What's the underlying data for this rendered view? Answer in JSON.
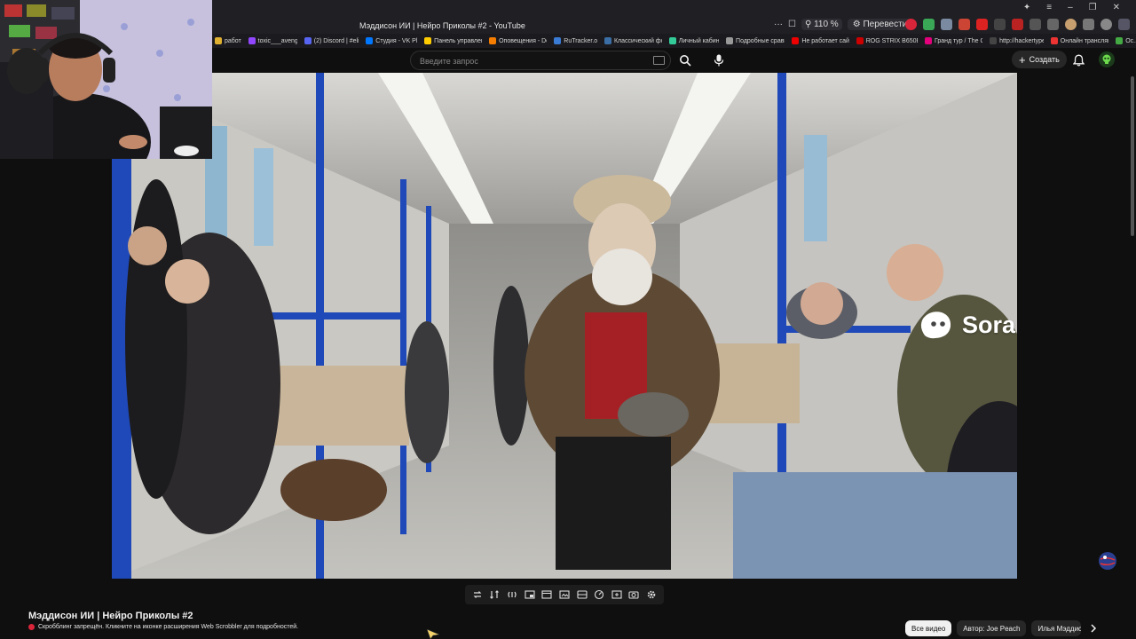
{
  "browser": {
    "title": "Мэддисон ИИ | Нейро Приколы #2 - YouTube",
    "zoom": "110 %",
    "translate_label": "Перевести",
    "ellipsis": "···"
  },
  "bookmarks": [
    {
      "label": "работа",
      "color": "#e0b030"
    },
    {
      "label": "toxic___avenger",
      "color": "#9146ff"
    },
    {
      "label": "(2) Discord | #elit...",
      "color": "#5865f2"
    },
    {
      "label": "Студия - VK Play",
      "color": "#0077ff"
    },
    {
      "label": "Панель управлен...",
      "color": "#ffcc00"
    },
    {
      "label": "Оповещения - Do...",
      "color": "#f57d00"
    },
    {
      "label": "RuTracker.org",
      "color": "#3a7bd5"
    },
    {
      "label": "Классический фо...",
      "color": "#3a6ea5"
    },
    {
      "label": "Личный кабинет",
      "color": "#3c9"
    },
    {
      "label": "Подробные сравн...",
      "color": "#999"
    },
    {
      "label": "Не работает сайт...",
      "color": "#e00"
    },
    {
      "label": "ROG STRIX B650E...",
      "color": "#c00"
    },
    {
      "label": "Гранд тур / The G...",
      "color": "#e4007c"
    },
    {
      "label": "http://hackertype...",
      "color": "#444"
    },
    {
      "label": "Онлайн трансляц...",
      "color": "#e33"
    },
    {
      "label": "Ос...",
      "color": "#4a4"
    }
  ],
  "header": {
    "search_placeholder": "Введите запрос",
    "create_label": "Создать"
  },
  "video": {
    "watermark": "Sora"
  },
  "info": {
    "title": "Мэддисон ИИ | Нейро Приколы #2",
    "scrobble_note": "Скробблинг запрещён. Кликните на иконке расширения Web Scrobbler для подробностей."
  },
  "chips": {
    "all_videos": "Все видео",
    "author": "Автор: Joe Peach",
    "channel": "Илья Мэддисон"
  },
  "colors": {
    "background": "#0f0f0f",
    "accent_red": "#d9253a"
  }
}
